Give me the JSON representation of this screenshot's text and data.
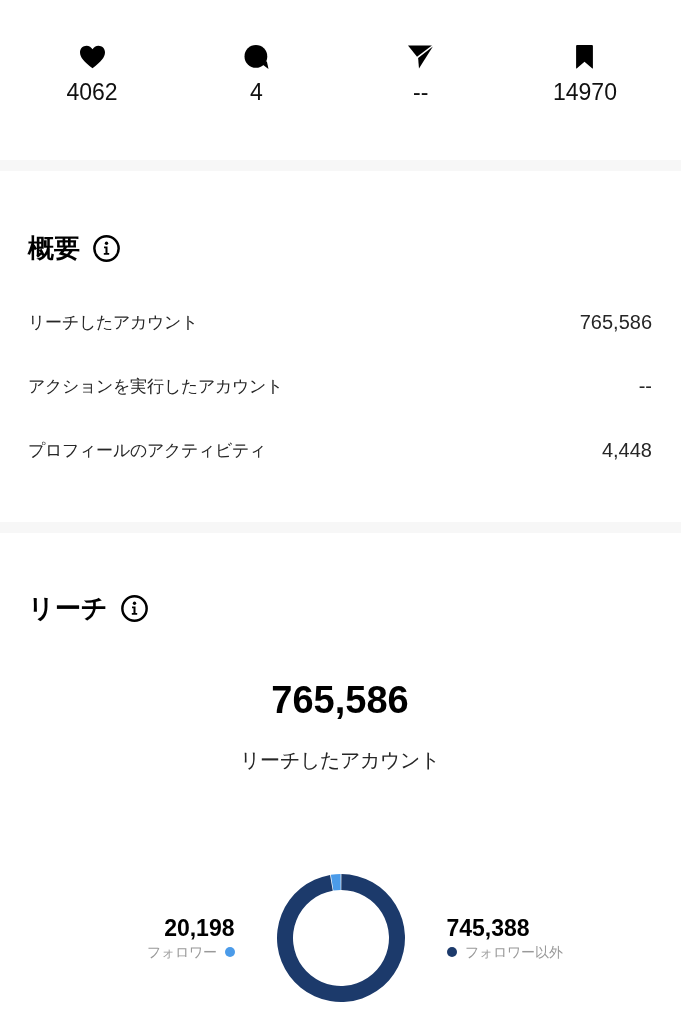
{
  "stats": [
    {
      "kind": "heart",
      "count": "4062"
    },
    {
      "kind": "comment",
      "count": "4"
    },
    {
      "kind": "share",
      "count": "--"
    },
    {
      "kind": "save",
      "count": "14970"
    }
  ],
  "overview": {
    "title": "概要",
    "rows": [
      {
        "label": "リーチしたアカウント",
        "value": "765,586"
      },
      {
        "label": "アクションを実行したアカウント",
        "value": "--"
      },
      {
        "label": "プロフィールのアクティビティ",
        "value": "4,448"
      }
    ]
  },
  "reach": {
    "title": "リーチ",
    "total": "765,586",
    "total_label": "リーチしたアカウント",
    "legend": [
      {
        "value": "20,198",
        "color": "#4b9be9"
      },
      {
        "value": "745,388",
        "color": "#1c3a6b"
      }
    ],
    "chart_data": {
      "type": "donut",
      "categories": [
        "フォロワー",
        "フォロワー以外"
      ],
      "values": [
        2.64,
        97.36
      ]
    }
  }
}
